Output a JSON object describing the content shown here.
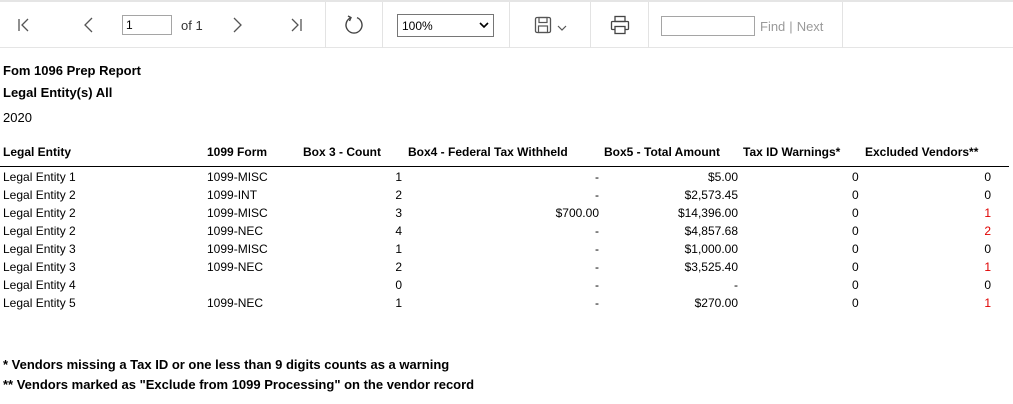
{
  "toolbar": {
    "page_value": "1",
    "of_label": "of 1",
    "zoom_value": "100%",
    "find_placeholder": "",
    "find_label": "Find",
    "next_label": "Next"
  },
  "report": {
    "title": "Fom 1096 Prep Report",
    "entity_filter": "Legal Entity(s) All",
    "year": "2020",
    "headers": [
      "Legal Entity",
      "1099 Form",
      "Box 3 - Count",
      "Box4 - Federal Tax Withheld",
      "Box5 - Total Amount",
      "Tax ID Warnings*",
      "Excluded Vendors**"
    ],
    "rows": [
      [
        "Legal Entity 1",
        "1099-MISC",
        "1",
        "-",
        "$5.00",
        "0",
        "0"
      ],
      [
        "Legal Entity 2",
        "1099-INT",
        "2",
        "-",
        "$2,573.45",
        "0",
        "0"
      ],
      [
        "Legal Entity 2",
        "1099-MISC",
        "3",
        "$700.00",
        "$14,396.00",
        "0",
        "1"
      ],
      [
        "Legal Entity 2",
        "1099-NEC",
        "4",
        "-",
        "$4,857.68",
        "0",
        "2"
      ],
      [
        "Legal Entity 3",
        "1099-MISC",
        "1",
        "-",
        "$1,000.00",
        "0",
        "0"
      ],
      [
        "Legal Entity 3",
        "1099-NEC",
        "2",
        "-",
        "$3,525.40",
        "0",
        "1"
      ],
      [
        "Legal Entity 4",
        "",
        "0",
        "-",
        "-",
        "0",
        "0"
      ],
      [
        "Legal Entity 5",
        "1099-NEC",
        "1",
        "-",
        "$270.00",
        "0",
        "1"
      ]
    ],
    "footnote1": "* Vendors missing a Tax ID or one less than 9 digits counts as a warning",
    "footnote2": "** Vendors marked as \"Exclude from 1099 Processing\" on the vendor record"
  },
  "colors": {
    "excluded_nonzero": "#e00000"
  }
}
